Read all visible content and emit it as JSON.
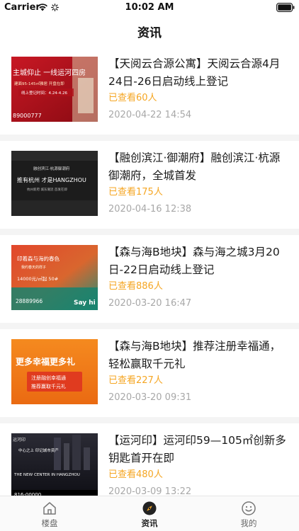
{
  "status_bar": {
    "carrier": "Carrier",
    "time": "10:02 AM",
    "icons": [
      "wifi-icon",
      "spinner-icon",
      "battery-icon"
    ]
  },
  "nav": {
    "title": "资讯"
  },
  "articles": [
    {
      "title": "【天阅云合源公寓】天阅云合源4月24日-26日启动线上登记",
      "views": "已查看60人",
      "date": "2020-04-22 14:54",
      "thumb": {
        "lines": [
          "主城仰止 一线运河四房",
          "建面95-145㎡雅居 开盘在即",
          "线上登记时间：4.24-4.26"
        ],
        "phone": "89000777"
      }
    },
    {
      "title": "【融创滨江·御潮府】融创滨江·杭源御潮府，全城首发",
      "views": "已查看175人",
      "date": "2020-04-16 12:38",
      "thumb": {
        "lines": [
          "融创滨江·杭源御潮府",
          "推有杭州 才是HANGZHOU",
          "杭州新府 城东潮流 首发在即"
        ]
      }
    },
    {
      "title": "【森与海B地块】森与海之城3月20日-22日启动线上登记",
      "views": "已查看886人",
      "date": "2020-03-20 16:47",
      "thumb": {
        "lines": [
          "印着森与海的春色",
          "我约春天的样子",
          "14000元/㎡起 50#",
          "Say hi"
        ],
        "phone": "28889966"
      }
    },
    {
      "title": "【森与海B地块】推荐注册幸福通，轻松赢取千元礼",
      "views": "已查看227人",
      "date": "2020-03-20 09:31",
      "thumb": {
        "lines": [
          "更多幸福更多礼",
          "注册融创幸福通",
          "推荐赢取千元礼"
        ]
      }
    },
    {
      "title": "【运河印】运河印59—105㎡创新多钥匙首开在即",
      "views": "已查看480人",
      "date": "2020-03-09 13:22",
      "thumb": {
        "lines": [
          "运河印",
          "中心之上 印记城市资产",
          "THE NEW CENTER IN HANGZHOU"
        ],
        "phone": "816-00000"
      }
    }
  ],
  "tab_bar": {
    "tabs": [
      {
        "label": "楼盘",
        "icon": "house-icon",
        "active": false
      },
      {
        "label": "资讯",
        "icon": "compass-icon",
        "active": true
      },
      {
        "label": "我的",
        "icon": "smiley-icon",
        "active": false
      }
    ],
    "accent": "#f5a623"
  }
}
